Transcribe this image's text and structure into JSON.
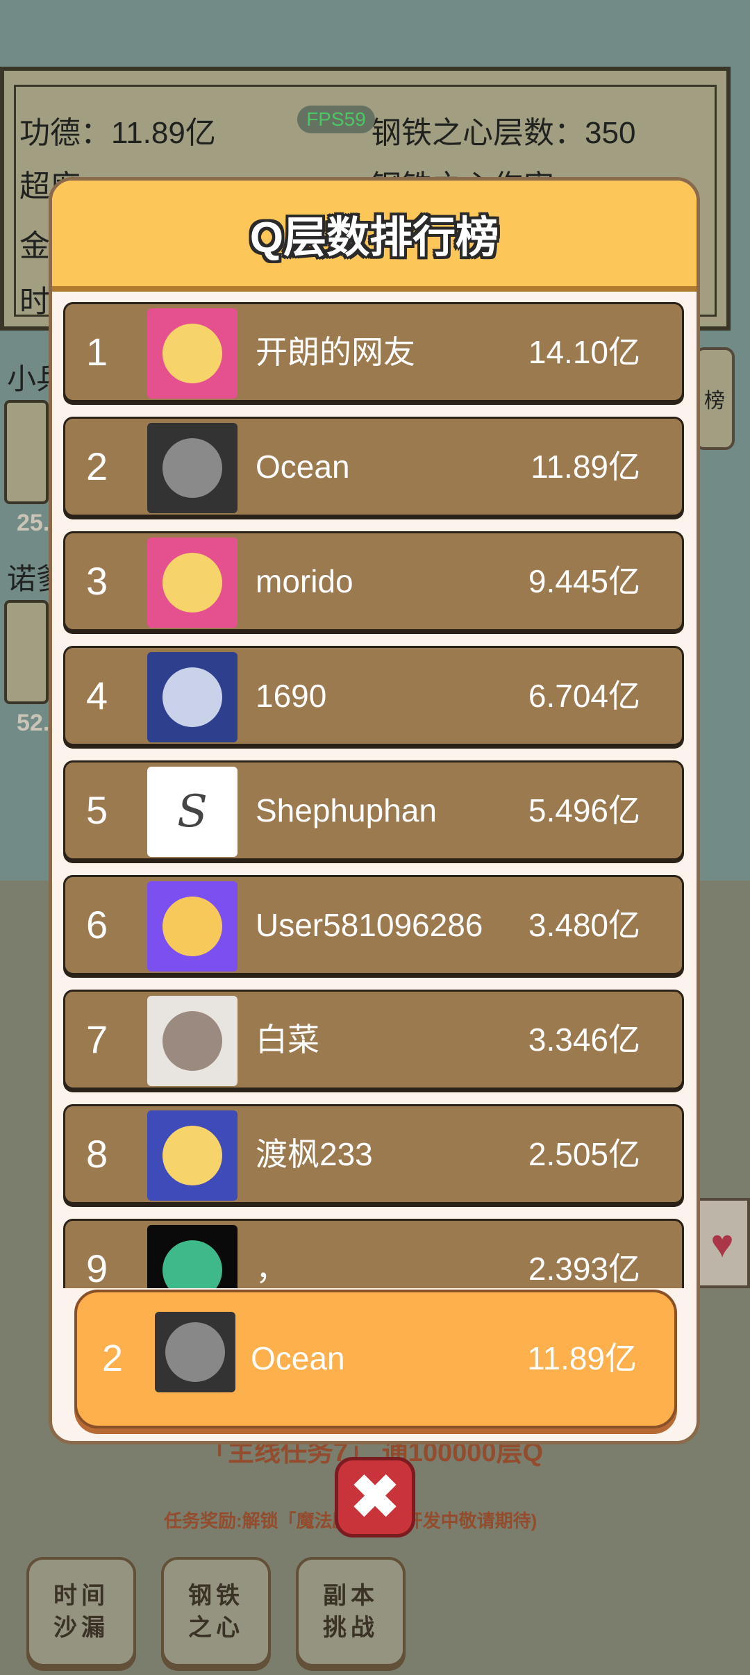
{
  "background": {
    "stats": {
      "merit": "功德：11.89亿",
      "steel_heart_layers": "钢铁之心层数：350",
      "line2_left": "超度：",
      "line2_right": "钢铁之心伤害：",
      "line3_left": "金",
      "line4_left": "时"
    },
    "fps": "FPS59",
    "side_labels": [
      "小兵",
      "诺爹"
    ],
    "side_card_values": [
      "25.",
      "52."
    ],
    "right_tab_label": "榜",
    "task_text": "「主线任务7」 通100000层Q",
    "task_reward": "任务奖励:解锁「魔法殿…尚在开发中敬请期待)",
    "bottom_buttons": [
      "时间\n沙漏",
      "钢铁\n之心",
      "副本\n挑战"
    ]
  },
  "leaderboard": {
    "title": "Q层数排行榜",
    "rows": [
      {
        "rank": "1",
        "name": "开朗的网友",
        "score": "14.10亿",
        "avatar": "anime-girl-avatar",
        "avatar_bg": "#e5508f"
      },
      {
        "rank": "2",
        "name": "Ocean",
        "score": "11.89亿",
        "avatar": "man-photo-avatar",
        "avatar_bg": "#333333"
      },
      {
        "rank": "3",
        "name": "morido",
        "score": "9.445亿",
        "avatar": "anime-girl-avatar",
        "avatar_bg": "#e5508f"
      },
      {
        "rank": "4",
        "name": "1690",
        "score": "6.704亿",
        "avatar": "robot-avatar",
        "avatar_bg": "#2e3f8e"
      },
      {
        "rank": "5",
        "name": "Shephuphan",
        "score": "5.496亿",
        "avatar": "letter-s-avatar",
        "avatar_bg": "#ffffff"
      },
      {
        "rank": "6",
        "name": "User581096286",
        "score": "3.480亿",
        "avatar": "anime-girl-star-eyes-avatar",
        "avatar_bg": "#7b4ff0"
      },
      {
        "rank": "7",
        "name": "白菜",
        "score": "3.346亿",
        "avatar": "anime-soldier-avatar",
        "avatar_bg": "#e8e4e0"
      },
      {
        "rank": "8",
        "name": "渡枫233",
        "score": "2.505亿",
        "avatar": "anime-girl-avatar",
        "avatar_bg": "#3e4bb8"
      },
      {
        "rank": "9",
        "name": "，",
        "score": "2.393亿",
        "avatar": "planet-avatar",
        "avatar_bg": "#0a0a0a"
      }
    ],
    "self": {
      "rank": "2",
      "name": "Ocean",
      "score": "11.89亿",
      "avatar": "man-photo-avatar",
      "avatar_bg": "#333333"
    }
  },
  "close_icon": "✖"
}
